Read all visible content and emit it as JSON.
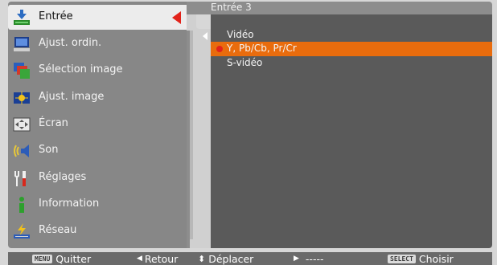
{
  "sidebar": {
    "items": [
      {
        "label": "Entrée",
        "icon": "input-icon"
      },
      {
        "label": "Ajust. ordin.",
        "icon": "computer-adjust-icon"
      },
      {
        "label": "Sélection image",
        "icon": "image-select-icon"
      },
      {
        "label": "Ajust. image",
        "icon": "image-adjust-icon"
      },
      {
        "label": "Écran",
        "icon": "screen-icon"
      },
      {
        "label": "Son",
        "icon": "sound-icon"
      },
      {
        "label": "Réglages",
        "icon": "settings-icon"
      },
      {
        "label": "Information",
        "icon": "information-icon"
      },
      {
        "label": "Réseau",
        "icon": "network-icon"
      }
    ],
    "active_index": 0
  },
  "panel": {
    "title": "Entrée 3",
    "options": [
      {
        "label": "Vidéo",
        "selected": false
      },
      {
        "label": "Y, Pb/Cb, Pr/Cr",
        "selected": true
      },
      {
        "label": "S-vidéo",
        "selected": false
      }
    ]
  },
  "footer": {
    "menu_key": "MENU",
    "quit": "Quitter",
    "back": "Retour",
    "move": "Déplacer",
    "next": "-----",
    "select_key": "SELECT",
    "choose": "Choisir"
  },
  "colors": {
    "sidebar_bg": "#878787",
    "panel_bg": "#5a5a5a",
    "highlight": "#e96c0d",
    "active_marker": "#e2231a"
  }
}
